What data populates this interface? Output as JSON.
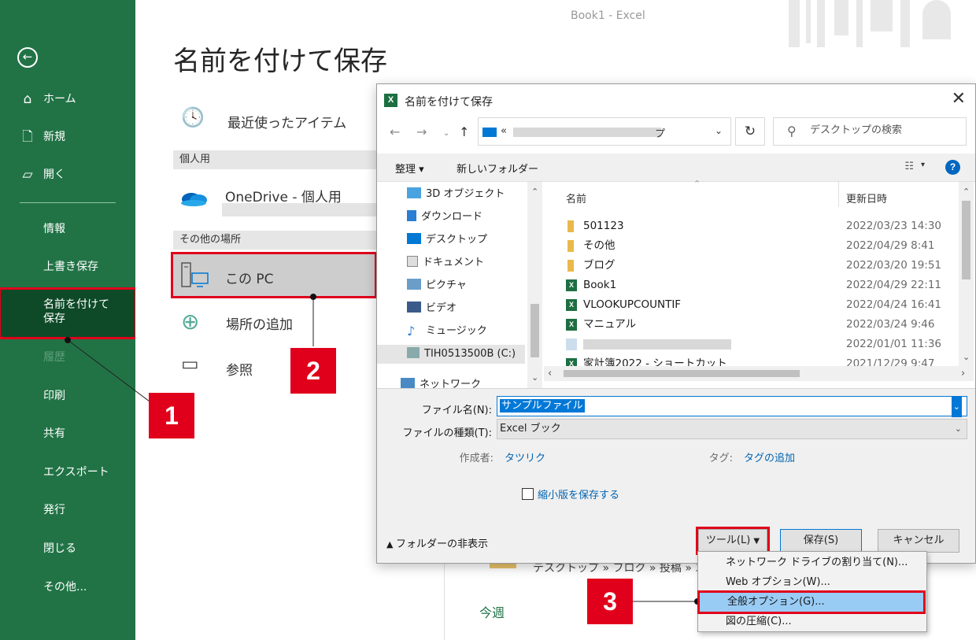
{
  "nav": {
    "items": [
      "ホーム",
      "新規",
      "開く",
      "情報",
      "上書き保存",
      "名前を付けて保存",
      "履歴",
      "印刷",
      "共有",
      "エクスポート",
      "発行",
      "閉じる",
      "その他..."
    ]
  },
  "window": {
    "title": "Book1  -  Excel"
  },
  "backstage": {
    "title": "名前を付けて保存",
    "recent": "最近使ったアイテム",
    "personal_header": "個人用",
    "onedrive": "OneDrive - 個人用",
    "other_header": "その他の場所",
    "this_pc": "この PC",
    "add_place": "場所の追加",
    "browse": "参照",
    "breadcrumb_hint": "テスクトップ » フロク » 投稿 » エクセ",
    "this_week": "今週"
  },
  "callouts": [
    "1",
    "2",
    "3"
  ],
  "dialog": {
    "title": "名前を付けて保存",
    "address_prefix": "«",
    "address_suffix": "プ",
    "search_placeholder": "デスクトップの検索",
    "organize": "整理 ▾",
    "new_folder": "新しいフォルダー",
    "help": "?",
    "tree": [
      "3D オブジェクト",
      "ダウンロード",
      "デスクトップ",
      "ドキュメント",
      "ピクチャ",
      "ビデオ",
      "ミュージック",
      "TIH0513500B (C:)",
      "ネットワーク"
    ],
    "columns": {
      "name": "名前",
      "date": "更新日時"
    },
    "files": [
      {
        "type": "folder",
        "name": "501123",
        "date": "2022/03/23 14:30"
      },
      {
        "type": "folder",
        "name": "その他",
        "date": "2022/04/29 8:41"
      },
      {
        "type": "folder",
        "name": "ブログ",
        "date": "2022/03/20 19:51"
      },
      {
        "type": "xls",
        "name": "Book1",
        "date": "2022/04/29 22:11"
      },
      {
        "type": "xls",
        "name": "VLOOKUPCOUNTIF",
        "date": "2022/04/24 16:41"
      },
      {
        "type": "xls",
        "name": "マニュアル",
        "date": "2022/03/24 9:46"
      },
      {
        "type": "lnk",
        "name": "",
        "date": "2022/01/01 11:36"
      },
      {
        "type": "xls",
        "name": "家計簿2022 - ショートカット",
        "date": "2021/12/29 9:47"
      }
    ],
    "filename_label": "ファイル名(N):",
    "filename_value": "サンプルファイル",
    "filetype_label": "ファイルの種類(T):",
    "filetype_value": "Excel ブック",
    "author_label": "作成者:",
    "author_value": "タツリク",
    "tag_label": "タグ:",
    "tag_value": "タグの追加",
    "thumbnail": "縮小版を保存する",
    "hide_folders": "フォルダーの非表示",
    "tools": "ツール(L)",
    "save": "保存(S)",
    "cancel": "キャンセル"
  },
  "menu": {
    "items": [
      "ネットワーク ドライブの割り当て(N)...",
      "Web オプション(W)...",
      "全般オプション(G)...",
      "図の圧縮(C)..."
    ]
  },
  "colors": {
    "excel_green": "#217346",
    "nav_selected": "#0e4a28",
    "callout_red": "#e0001b",
    "accent_blue": "#0078d7",
    "menu_highlight": "#99ccf5"
  }
}
